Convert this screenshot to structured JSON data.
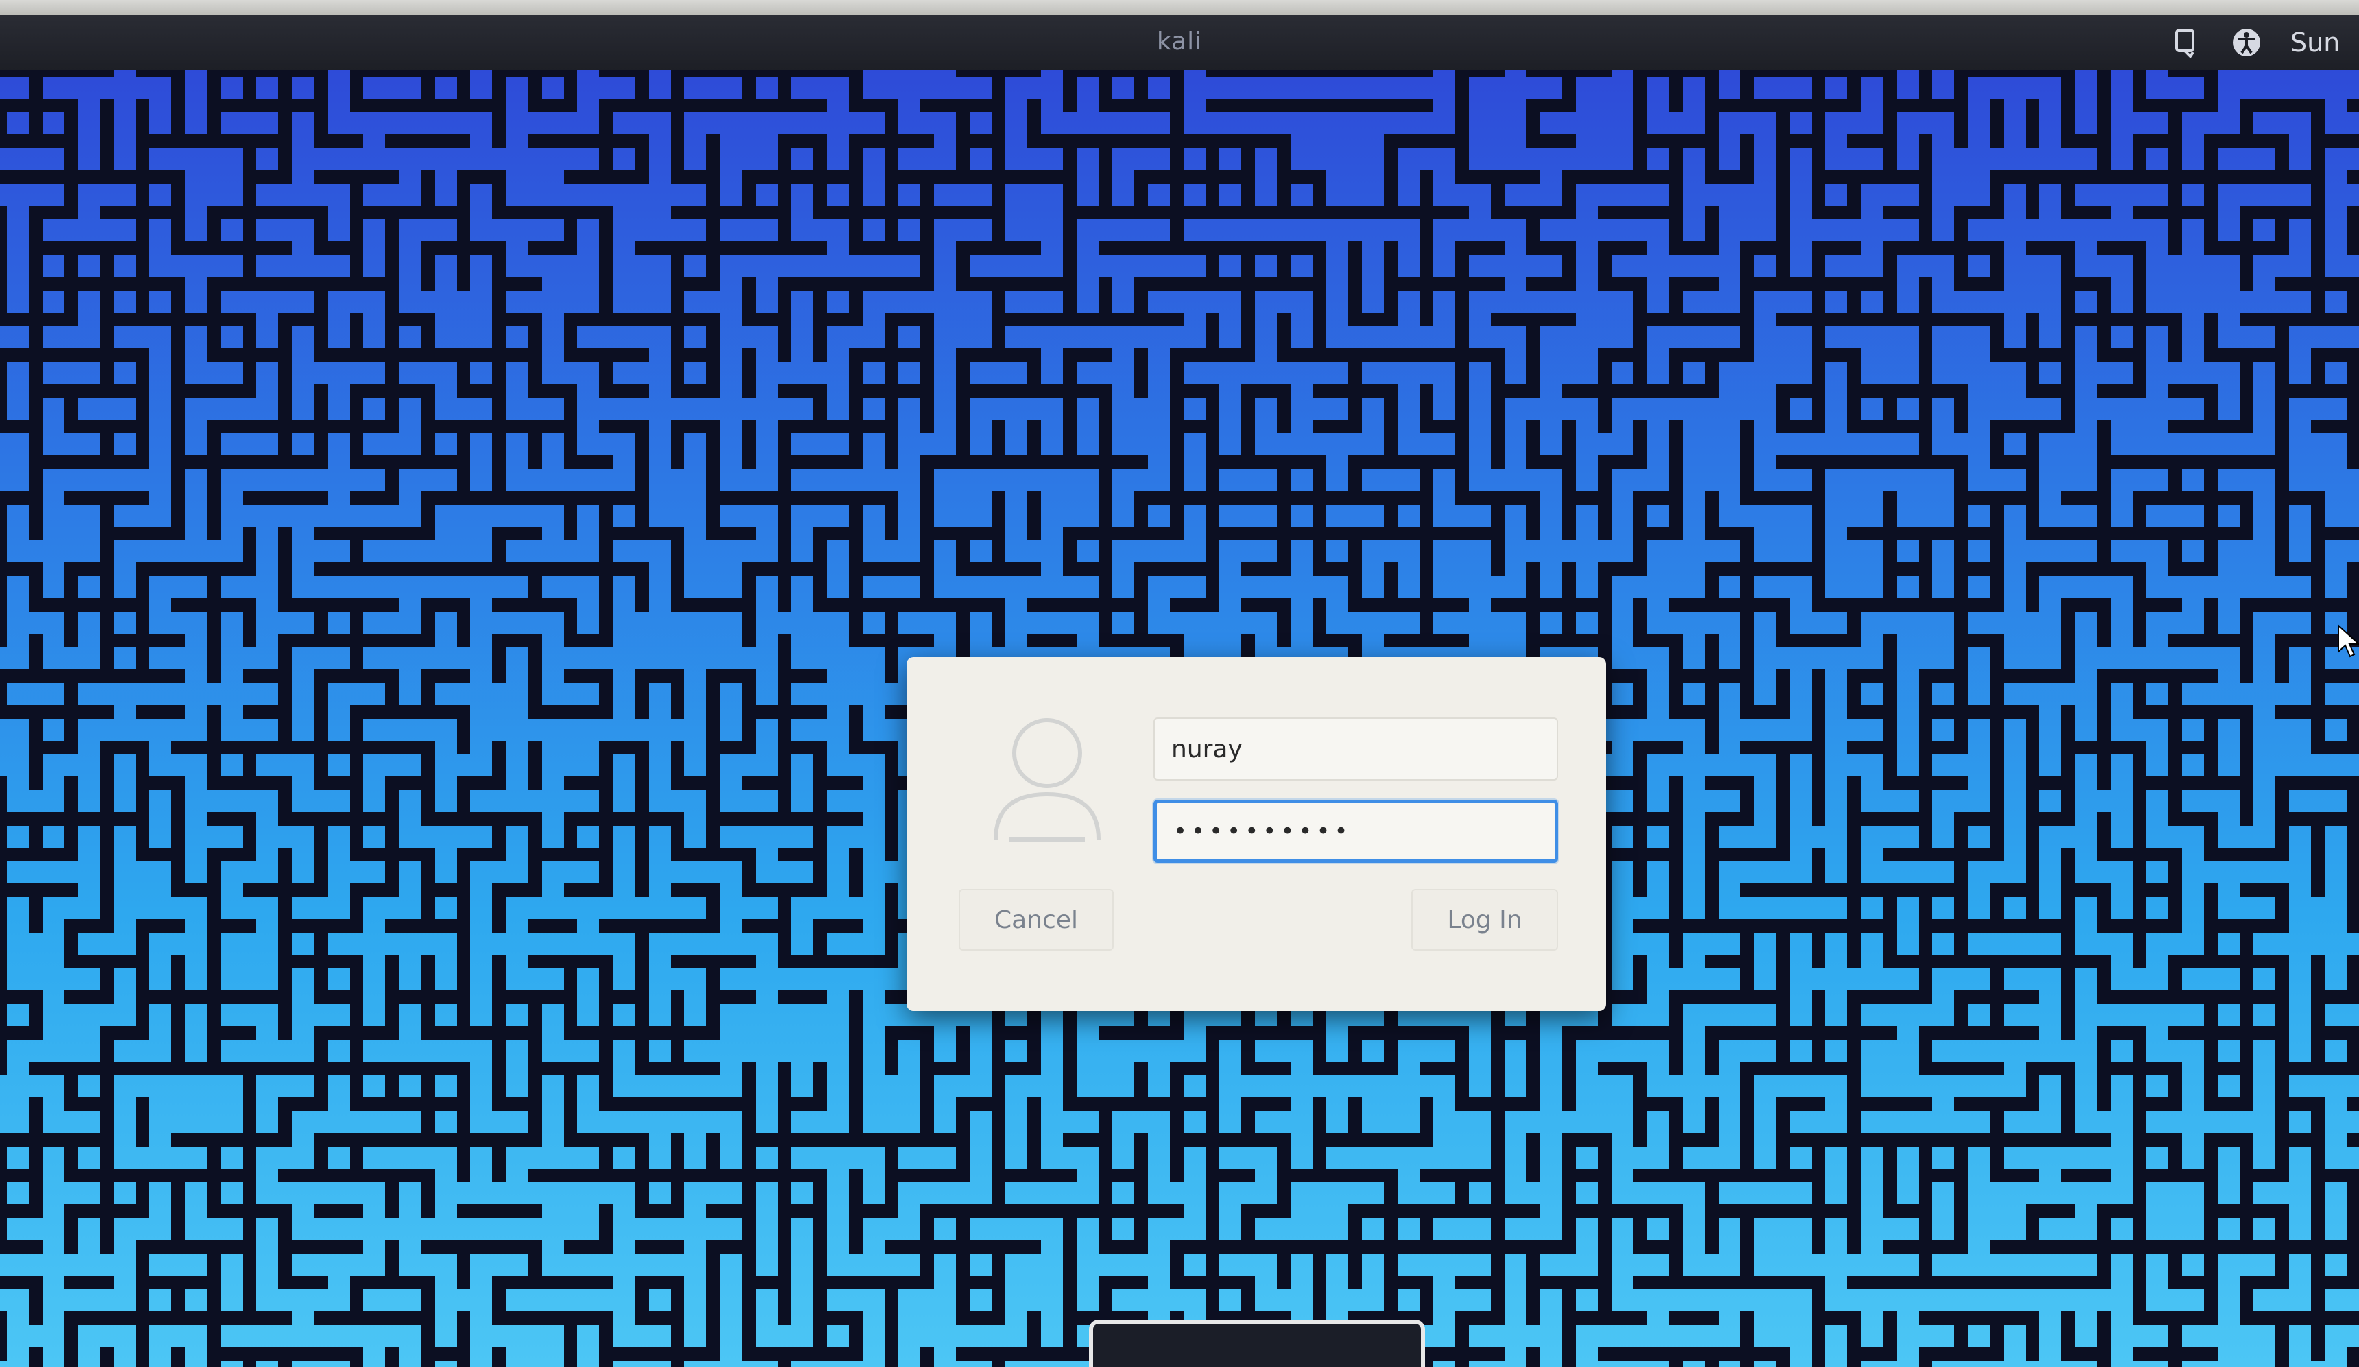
{
  "panel": {
    "hostname": "kali",
    "clock": "Sun"
  },
  "login": {
    "username_value": "nuray",
    "password_value": "••••••••••",
    "cancel_label": "Cancel",
    "login_label": "Log In"
  },
  "colors": {
    "accent": "#3f8ee6",
    "dialog_bg": "#f1efe9",
    "panel_bg": "#1d1f26",
    "wallpaper_top": "#2e4bd8",
    "wallpaper_bottom": "#4cc6f5"
  },
  "icons": {
    "panel_left": "screen-reader-icon",
    "panel_right": "accessibility-icon",
    "avatar": "user-avatar-icon"
  }
}
